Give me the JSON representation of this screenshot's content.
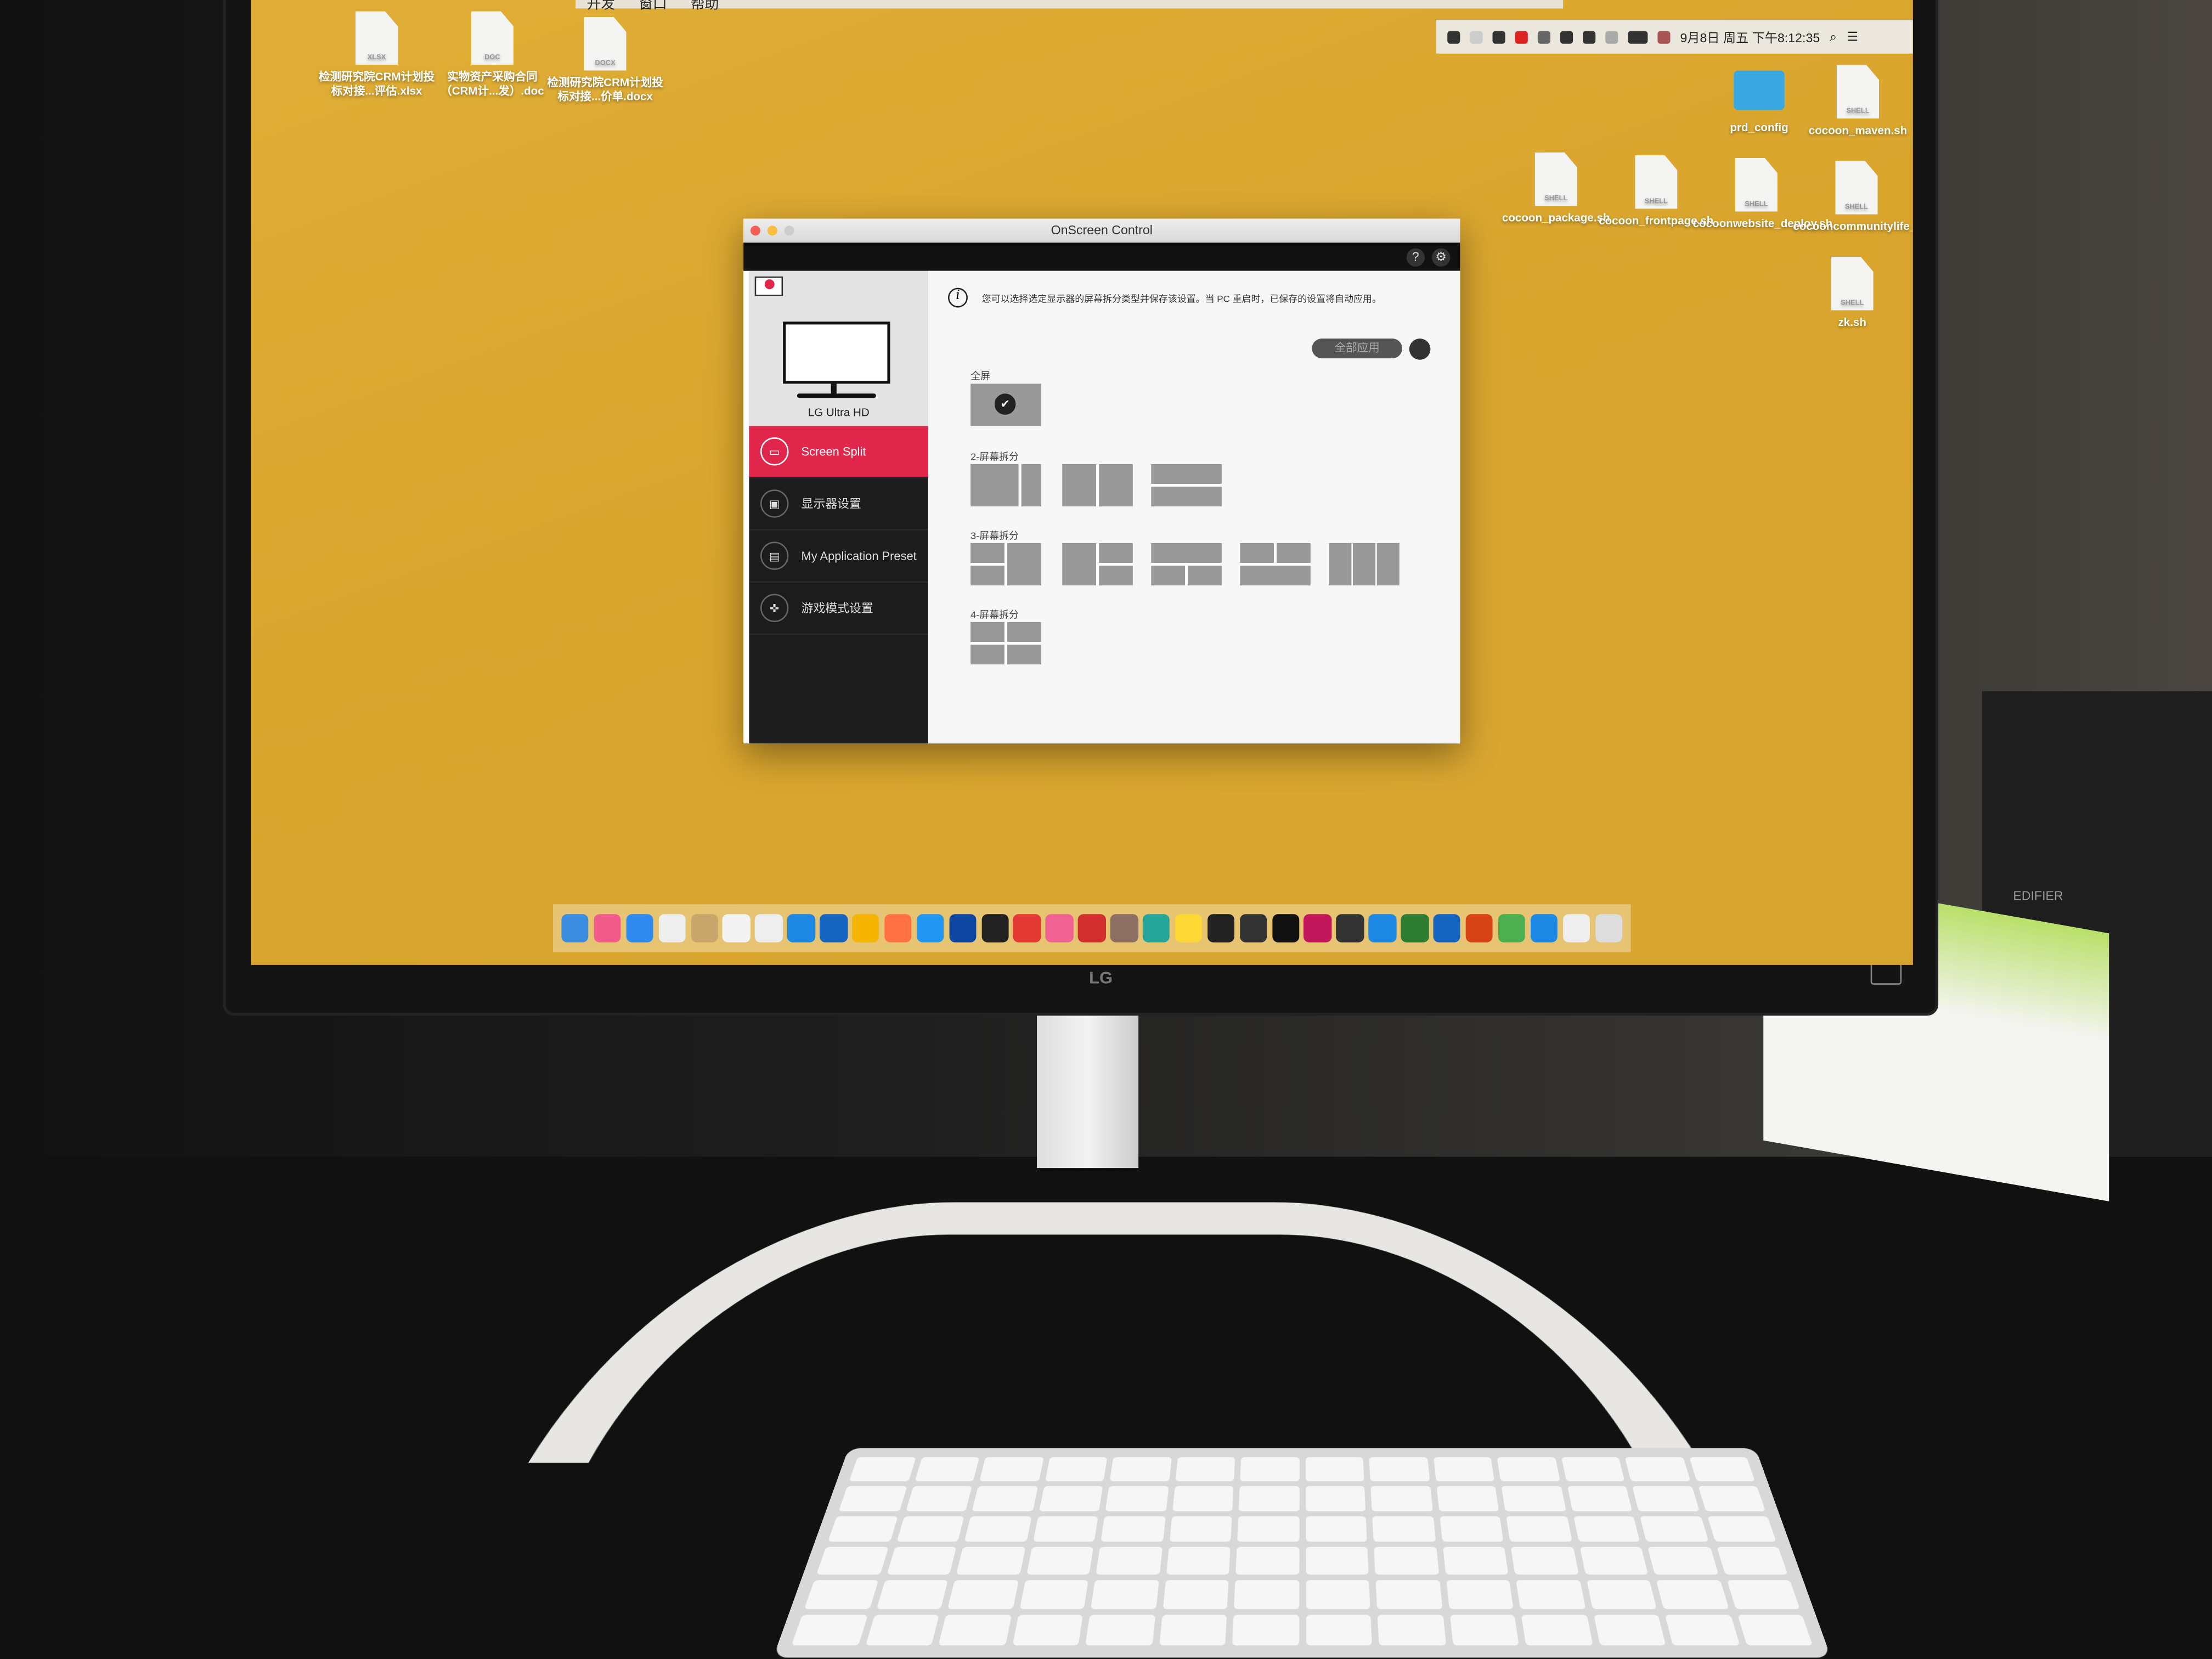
{
  "menubar": {
    "menus": [
      "开发",
      "窗口",
      "帮助"
    ],
    "status_icons": [
      "wifi-lock-icon",
      "dictionary-icon",
      "lock-icon",
      "record-icon",
      "bluetooth-icon",
      "wifi-icon",
      "airplay-icon",
      "volume-icon",
      "battery-charging-icon",
      "us-flag-icon"
    ],
    "clock": "9月8日 周五 下午8:12:35",
    "search_icon": "magnifier-icon",
    "notification_icon": "list-icon"
  },
  "desktop": {
    "left_files": [
      {
        "name": "检测研究院CRM计划投标对接...评估.xlsx",
        "type": "XLSX"
      },
      {
        "name": "实物资产采购合同（CRM计...发）.doc",
        "type": "DOC"
      },
      {
        "name": "检测研究院CRM计划投标对接...价单.docx",
        "type": "DOCX"
      }
    ],
    "right_files": [
      {
        "name": "prd_config",
        "type": "folder"
      },
      {
        "name": "cocoon_maven.sh",
        "type": "SHELL"
      },
      {
        "name": "cocoon_package.sh",
        "type": "SHELL"
      },
      {
        "name": "cocoon_frontpage.sh",
        "type": "SHELL"
      },
      {
        "name": "cocoonwebsite_deploy.sh",
        "type": "SHELL"
      },
      {
        "name": "cocooncommunitylife_deploy.sh",
        "type": "SHELL"
      },
      {
        "name": "zk.sh",
        "type": "SHELL"
      }
    ]
  },
  "window": {
    "title": "OnScreen Control",
    "help_label": "?",
    "settings_icon": "gear-icon",
    "monitor_name": "LG Ultra HD",
    "nav": [
      {
        "label": "Screen Split",
        "icon": "monitor-icon",
        "active": true
      },
      {
        "label": "显示器设置",
        "icon": "display-settings-icon",
        "active": false
      },
      {
        "label": "My Application Preset",
        "icon": "app-preset-icon",
        "active": false
      },
      {
        "label": "游戏模式设置",
        "icon": "gamepad-icon",
        "active": false
      }
    ],
    "info_text": "您可以选择选定显示器的屏幕拆分类型并保存该设置。当 PC 重启时，已保存的设置将自动应用。",
    "apply_all_label": "全部应用",
    "sections": [
      {
        "title": "全屏",
        "layouts": 1,
        "selected": 0
      },
      {
        "title": "2-屏幕拆分",
        "layouts": 3
      },
      {
        "title": "3-屏幕拆分",
        "layouts": 5
      },
      {
        "title": "4-屏幕拆分",
        "layouts": 1
      }
    ],
    "accent_color": "#e0264b"
  },
  "monitor": {
    "brand": "LG"
  },
  "speaker": {
    "brand": "EDIFIER"
  },
  "dock_colors": [
    "#3b8de0",
    "#f25c8a",
    "#2f8bf0",
    "#eee",
    "#c9a66b",
    "#f3f3f3",
    "#eee",
    "#1e88e5",
    "#1565c0",
    "#f4b400",
    "#ff7043",
    "#2196f3",
    "#0d47a1",
    "#222",
    "#e53935",
    "#f06292",
    "#d32f2f",
    "#8d6e63",
    "#26a69a",
    "#fdd835",
    "#222",
    "#333",
    "#111",
    "#c2185b",
    "#333",
    "#1e88e5",
    "#2e7d32",
    "#1565c0",
    "#d84315",
    "#4caf50",
    "#1e88e5",
    "#eee",
    "#ddd"
  ]
}
